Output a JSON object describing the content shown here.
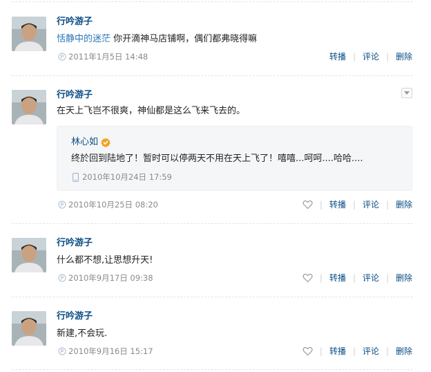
{
  "colors": {
    "link": "#0a4d85",
    "mention": "#2a74b9",
    "muted": "#8a8a8a",
    "separator": "#e3e3e3"
  },
  "actions": {
    "repost": "转播",
    "comment": "评论",
    "delete": "删除",
    "separator": "|"
  },
  "posts": [
    {
      "author": "行吟游子",
      "mention": "恬静中的迷茫",
      "text": " 你开滴神马店铺啊，偶们都弗晓得嘛",
      "time": "2011年1月5日 14:48",
      "has_like": false
    },
    {
      "author": "行吟游子",
      "text": "在天上飞岂不很爽，神仙都是这么飞来飞去的。",
      "time": "2010年10月25日 08:20",
      "has_like": true,
      "repost": {
        "author": "林心如",
        "text": "终於回到陆地了！暂时可以停两天不用在天上飞了！嘻嘻...呵呵....哈哈....",
        "time": "2010年10月24日 17:59"
      }
    },
    {
      "author": "行吟游子",
      "text": "什么都不想,让思想升天!",
      "time": "2010年9月17日 09:38",
      "has_like": true
    },
    {
      "author": "行吟游子",
      "text": "新建,不会玩.",
      "time": "2010年9月16日 15:17",
      "has_like": true
    }
  ]
}
